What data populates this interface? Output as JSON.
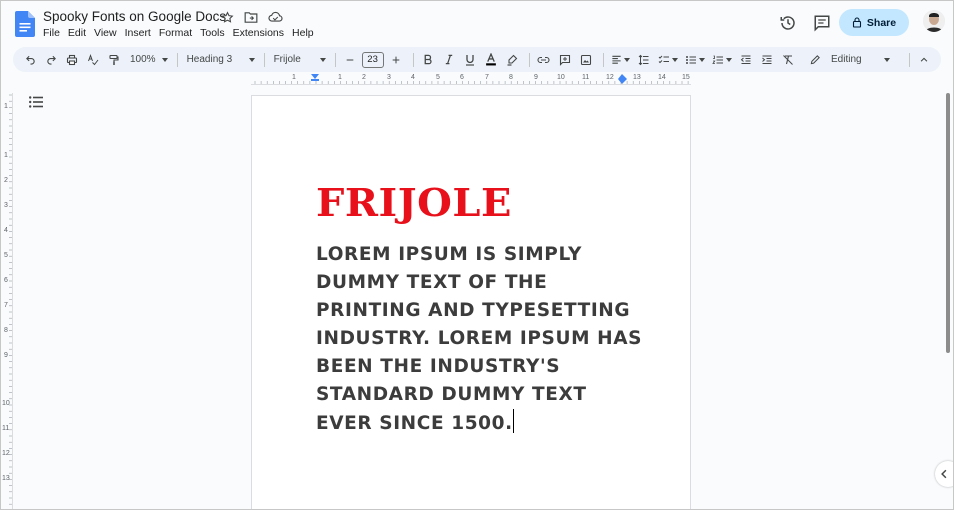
{
  "header": {
    "title": "Spooky Fonts on Google Docs",
    "menu": [
      "File",
      "Edit",
      "View",
      "Insert",
      "Format",
      "Tools",
      "Extensions",
      "Help"
    ],
    "share_label": "Share"
  },
  "toolbar": {
    "zoom": "100%",
    "style": "Heading 3",
    "font": "Frijole",
    "font_size": "23",
    "mode": "Editing"
  },
  "ruler": {
    "ticks": [
      "1",
      "1",
      "2",
      "3",
      "4",
      "5",
      "6",
      "7",
      "8",
      "9",
      "10",
      "11",
      "12",
      "13",
      "14",
      "15"
    ]
  },
  "vruler": {
    "ticks": [
      "1",
      "1",
      "2",
      "3",
      "4",
      "5",
      "6",
      "7",
      "8",
      "9",
      "10",
      "11",
      "12",
      "13"
    ]
  },
  "document": {
    "heading": "Frijole",
    "body": "Lorem Ipsum is simply dummy text of the printing and typesetting industry. Lorem Ipsum has been the industry's standard dummy text ever since 1500."
  },
  "colors": {
    "heading": "#e8101a",
    "share_bg": "#c2e7ff",
    "toolbar_bg": "#edf2fa",
    "docs_blue": "#4285f4"
  }
}
